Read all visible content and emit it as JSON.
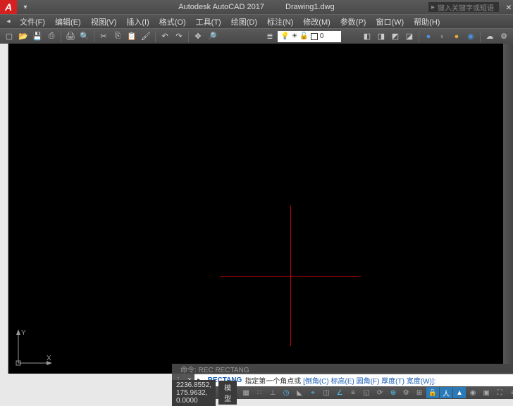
{
  "title": {
    "app": "Autodesk AutoCAD 2017",
    "doc": "Drawing1.dwg"
  },
  "search": {
    "placeholder": "键入关键字或短语"
  },
  "logo": "A",
  "menus": [
    {
      "label": "文件(F)"
    },
    {
      "label": "编辑(E)"
    },
    {
      "label": "视图(V)"
    },
    {
      "label": "插入(I)"
    },
    {
      "label": "格式(O)"
    },
    {
      "label": "工具(T)"
    },
    {
      "label": "绘图(D)"
    },
    {
      "label": "标注(N)"
    },
    {
      "label": "修改(M)"
    },
    {
      "label": "参数(P)"
    },
    {
      "label": "窗口(W)"
    },
    {
      "label": "帮助(H)"
    }
  ],
  "layer": {
    "name": "0"
  },
  "ucs": {
    "x": "X",
    "y": "Y"
  },
  "command": {
    "history": "命令: REC RECTANG",
    "icon": "⌨",
    "active": "RECTANG",
    "prompt_text": "指定第一个角点或",
    "options": "[倒角(C) 标高(E) 圆角(F) 厚度(T) 宽度(W)]:"
  },
  "status": {
    "coords": "2236.8552, 175.9632, 0.0000",
    "space": "模型"
  }
}
